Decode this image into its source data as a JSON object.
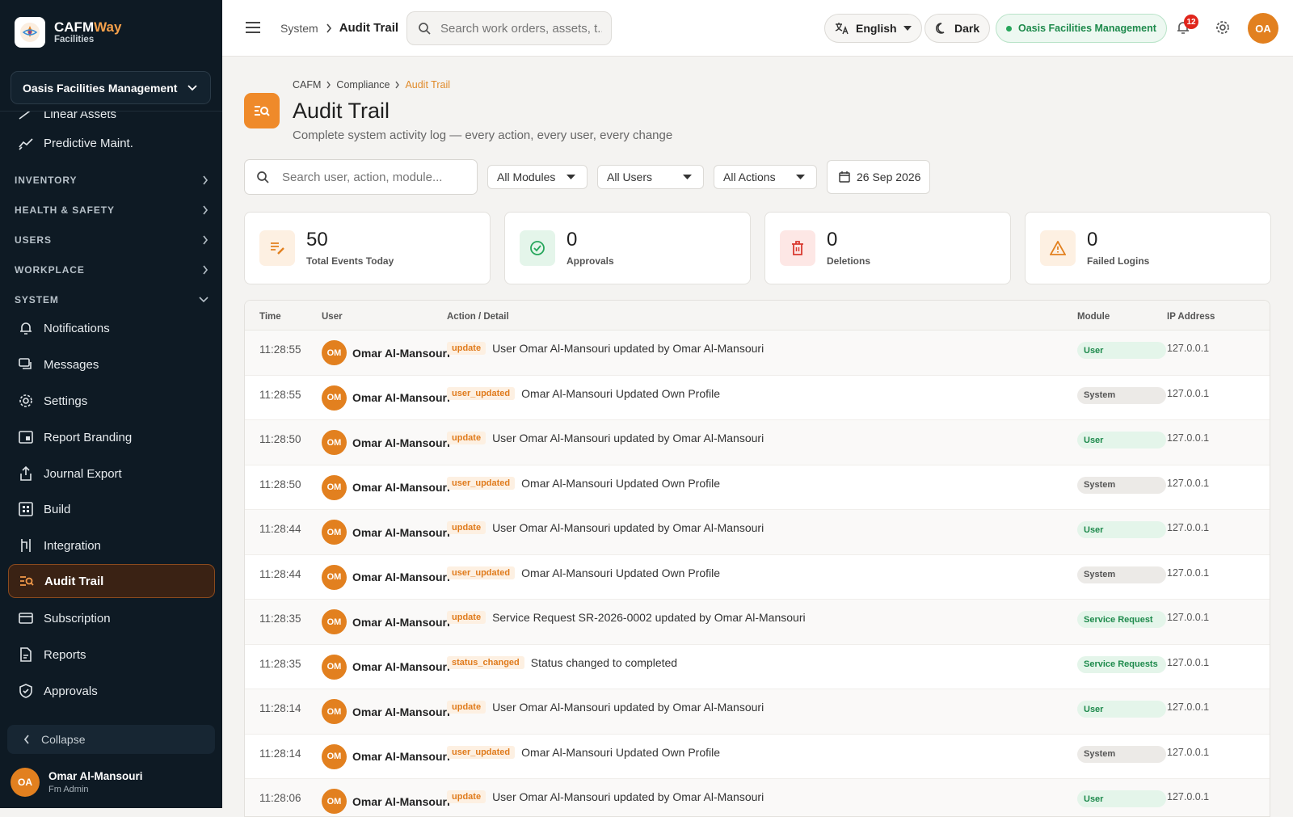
{
  "app": {
    "name_part1": "CAFM",
    "name_part2": "Way",
    "sub": "Facilities"
  },
  "org_selector": "Oasis Facilities Management",
  "sidebar": {
    "partial_item": "Linear Assets",
    "predictive": "Predictive Maint.",
    "sections": [
      {
        "label": "INVENTORY"
      },
      {
        "label": "HEALTH & SAFETY"
      },
      {
        "label": "USERS"
      },
      {
        "label": "WORKPLACE"
      },
      {
        "label": "SYSTEM"
      }
    ],
    "items": [
      {
        "label": "Notifications",
        "icon": "bell-icon"
      },
      {
        "label": "Messages",
        "icon": "messages-icon"
      },
      {
        "label": "Settings",
        "icon": "gear-icon"
      },
      {
        "label": "Report Branding",
        "icon": "branding-icon"
      },
      {
        "label": "Journal Export",
        "icon": "export-icon"
      },
      {
        "label": "Build",
        "icon": "build-icon"
      },
      {
        "label": "Integration",
        "icon": "integration-icon"
      },
      {
        "label": "Audit Trail",
        "icon": "audit-icon",
        "active": true
      },
      {
        "label": "Subscription",
        "icon": "card-icon"
      },
      {
        "label": "Reports",
        "icon": "reports-icon"
      },
      {
        "label": "Approvals",
        "icon": "shield-icon"
      }
    ],
    "collapse": "Collapse",
    "user": {
      "initials": "OA",
      "name": "Omar Al-Mansouri",
      "role": "Fm Admin"
    }
  },
  "topbar": {
    "crumb_parent": "System",
    "crumb_current": "Audit Trail",
    "search_placeholder": "Search work orders, assets, t...",
    "language": "English",
    "theme": "Dark",
    "org": "Oasis Facilities Management",
    "notif_count": "12",
    "avatar": "OA"
  },
  "page": {
    "crumbs": [
      "CAFM",
      "Compliance",
      "Audit Trail"
    ],
    "title": "Audit Trail",
    "subtitle": "Complete system activity log — every action, every user, every change"
  },
  "filters": {
    "search_placeholder": "Search user, action, module...",
    "modules": "All Modules",
    "users": "All Users",
    "actions": "All Actions",
    "date": "26 Sep 2026"
  },
  "stats": [
    {
      "value": "50",
      "label": "Total Events Today",
      "color": "#e2801f"
    },
    {
      "value": "0",
      "label": "Approvals",
      "color": "#26a65b"
    },
    {
      "value": "0",
      "label": "Deletions",
      "color": "#d93a30"
    },
    {
      "value": "0",
      "label": "Failed Logins",
      "color": "#e2801f"
    }
  ],
  "table": {
    "headers": {
      "time": "Time",
      "user": "User",
      "action": "Action / Detail",
      "module": "Module",
      "ip": "IP Address"
    },
    "rows": [
      {
        "time": "11:28:55",
        "initials": "OM",
        "user": "Omar Al-Mansouri",
        "tag": "update",
        "detail": "User Omar Al-Mansouri updated by Omar Al-Mansouri",
        "module": "User",
        "mod_style": "green",
        "ip": "127.0.0.1"
      },
      {
        "time": "11:28:55",
        "initials": "OM",
        "user": "Omar Al-Mansouri",
        "tag": "user_updated",
        "detail": "Omar Al-Mansouri Updated Own Profile",
        "module": "System",
        "mod_style": "gray",
        "ip": "127.0.0.1"
      },
      {
        "time": "11:28:50",
        "initials": "OM",
        "user": "Omar Al-Mansouri",
        "tag": "update",
        "detail": "User Omar Al-Mansouri updated by Omar Al-Mansouri",
        "module": "User",
        "mod_style": "green",
        "ip": "127.0.0.1"
      },
      {
        "time": "11:28:50",
        "initials": "OM",
        "user": "Omar Al-Mansouri",
        "tag": "user_updated",
        "detail": "Omar Al-Mansouri Updated Own Profile",
        "module": "System",
        "mod_style": "gray",
        "ip": "127.0.0.1"
      },
      {
        "time": "11:28:44",
        "initials": "OM",
        "user": "Omar Al-Mansouri",
        "tag": "update",
        "detail": "User Omar Al-Mansouri updated by Omar Al-Mansouri",
        "module": "User",
        "mod_style": "green",
        "ip": "127.0.0.1"
      },
      {
        "time": "11:28:44",
        "initials": "OM",
        "user": "Omar Al-Mansouri",
        "tag": "user_updated",
        "detail": "Omar Al-Mansouri Updated Own Profile",
        "module": "System",
        "mod_style": "gray",
        "ip": "127.0.0.1"
      },
      {
        "time": "11:28:35",
        "initials": "OM",
        "user": "Omar Al-Mansouri",
        "tag": "update",
        "detail": "Service Request SR-2026-0002 updated by Omar Al-Mansouri",
        "module": "Service Request",
        "mod_style": "green",
        "ip": "127.0.0.1"
      },
      {
        "time": "11:28:35",
        "initials": "OM",
        "user": "Omar Al-Mansouri",
        "tag": "status_changed",
        "detail": "Status changed to completed",
        "module": "Service Requests",
        "mod_style": "green",
        "ip": "127.0.0.1"
      },
      {
        "time": "11:28:14",
        "initials": "OM",
        "user": "Omar Al-Mansouri",
        "tag": "update",
        "detail": "User Omar Al-Mansouri updated by Omar Al-Mansouri",
        "module": "User",
        "mod_style": "green",
        "ip": "127.0.0.1"
      },
      {
        "time": "11:28:14",
        "initials": "OM",
        "user": "Omar Al-Mansouri",
        "tag": "user_updated",
        "detail": "Omar Al-Mansouri Updated Own Profile",
        "module": "System",
        "mod_style": "gray",
        "ip": "127.0.0.1"
      },
      {
        "time": "11:28:06",
        "initials": "OM",
        "user": "Omar Al-Mansouri",
        "tag": "update",
        "detail": "User Omar Al-Mansouri updated by Omar Al-Mansouri",
        "module": "User",
        "mod_style": "green",
        "ip": "127.0.0.1"
      }
    ]
  }
}
